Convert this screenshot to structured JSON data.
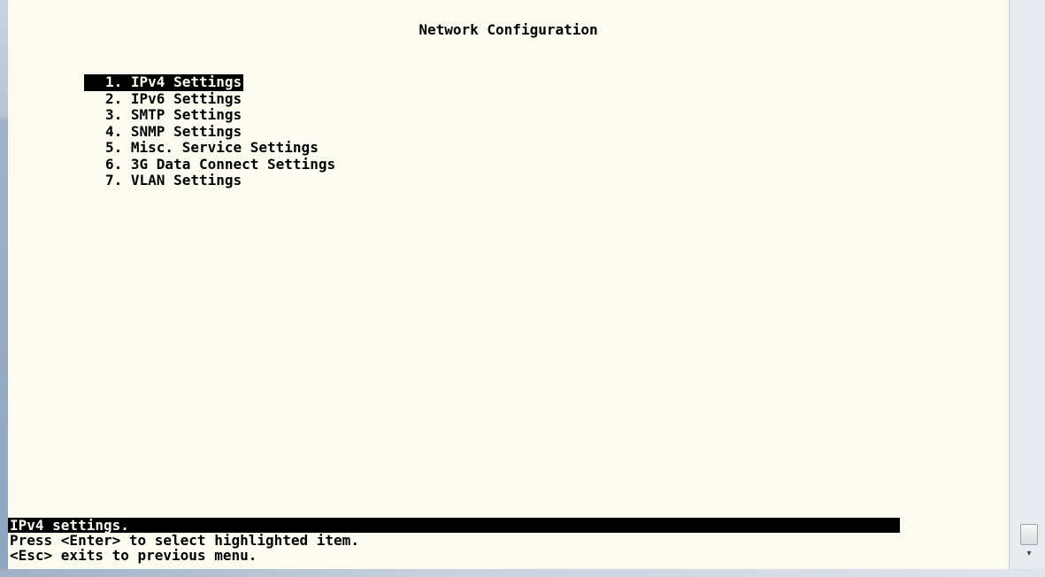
{
  "title": "Network Configuration",
  "menu": {
    "items": [
      {
        "label": "1. IPv4 Settings"
      },
      {
        "label": "2. IPv6 Settings"
      },
      {
        "label": "3. SMTP Settings"
      },
      {
        "label": "4. SNMP Settings"
      },
      {
        "label": "5. Misc. Service Settings"
      },
      {
        "label": "6. 3G Data Connect Settings"
      },
      {
        "label": "7. VLAN Settings"
      }
    ],
    "selected_index": 0
  },
  "status": {
    "description": "IPv4 settings.",
    "help_enter": "Press <Enter> to select highlighted item.",
    "help_esc": "<Esc> exits to previous menu."
  },
  "scrollbar": {
    "down_arrow": "▾",
    "icon": "scroll-down-arrow"
  },
  "colors": {
    "terminal_background": "#fbfbf0",
    "text": "#000000",
    "highlight": "#000000"
  }
}
